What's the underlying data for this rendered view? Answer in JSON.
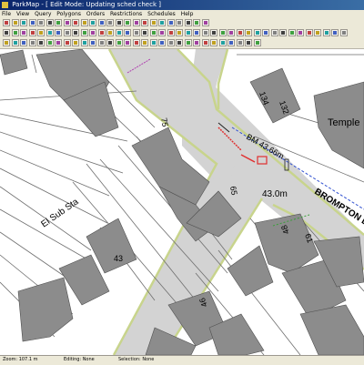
{
  "window": {
    "title": "ParkMap - [ Edit Mode: Updating sched check ]"
  },
  "menu": [
    "File",
    "View",
    "Query",
    "Polygons",
    "Orders",
    "Restrictions",
    "Schedules",
    "Help"
  ],
  "map": {
    "house_numbers": [
      "134",
      "132",
      "75",
      "65",
      "61",
      "48",
      "43",
      "46"
    ],
    "temple_label": "Temple",
    "el_sub_sta_label": "El Sub Sta",
    "bm_label": "BM 43.66m",
    "elevation_label": "43.0m",
    "road_label": "BROMPTON L"
  },
  "status": {
    "zoom": "Zoom: 107.1 m",
    "editing": "Editing: None",
    "selection": "Selection: None"
  },
  "colors": {
    "titlebar": "#0a246a",
    "road_fill": "#d3d3d3",
    "road_edge": "#c8d48c",
    "building": "#8c8c8c",
    "restriction_red": "#e03030",
    "restriction_blue": "#3050d0"
  }
}
